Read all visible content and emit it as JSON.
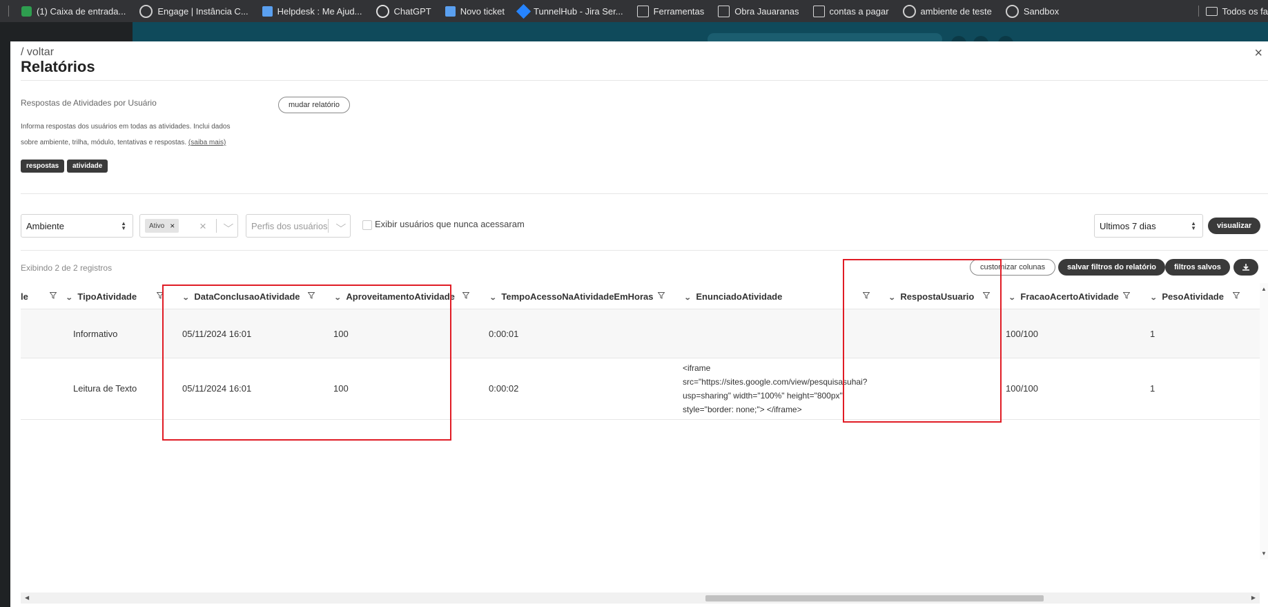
{
  "bookmarks": {
    "items": [
      {
        "label": "(1) Caixa de entrada...",
        "icon": "gmail-icon"
      },
      {
        "label": "Engage | Instância C...",
        "icon": "globe-icon"
      },
      {
        "label": "Helpdesk : Me Ajud...",
        "icon": "page-icon"
      },
      {
        "label": "ChatGPT",
        "icon": "chatgpt-icon"
      },
      {
        "label": "Novo ticket",
        "icon": "page-icon"
      },
      {
        "label": "TunnelHub - Jira Ser...",
        "icon": "jira-icon"
      },
      {
        "label": "Ferramentas",
        "icon": "folder-icon"
      },
      {
        "label": "Obra Jauaranas",
        "icon": "folder-icon"
      },
      {
        "label": "contas a pagar",
        "icon": "folder-icon"
      },
      {
        "label": "ambiente de teste",
        "icon": "globe-icon"
      },
      {
        "label": "Sandbox",
        "icon": "globe-icon"
      }
    ],
    "right_label": "Todos os fa"
  },
  "modal": {
    "back": "/ voltar",
    "title": "Relatórios",
    "close": "×"
  },
  "report": {
    "name": "Respostas de Atividades por Usuário",
    "change_button": "mudar relatório",
    "description": "Informa respostas dos usuários em todas as atividades. Inclui dados sobre ambiente, trilha, módulo, tentativas e respostas.",
    "more_link": "(saiba mais)",
    "tags": [
      "respostas",
      "atividade"
    ]
  },
  "filters": {
    "ambiente": "Ambiente",
    "status_chip": "Ativo",
    "status_chip_remove": "×",
    "clear": "×",
    "profiles_placeholder": "Perfis dos usuários",
    "never_accessed_label": "Exibir usuários que nunca acessaram",
    "period": "Ultimos 7 dias",
    "visualize_button": "visualizar"
  },
  "toolbar": {
    "records": "Exibindo 2 de 2 registros",
    "customize_columns": "customizar colunas",
    "save_filters": "salvar filtros do relatório",
    "saved_filters": "filtros salvos"
  },
  "table": {
    "columns": [
      "le",
      "TipoAtividade",
      "DataConclusaoAtividade",
      "AproveitamentoAtividade",
      "TempoAcessoNaAtividadeEmHoras",
      "EnunciadoAtividade",
      "RespostaUsuario",
      "FracaoAcertoAtividade",
      "PesoAtividade"
    ],
    "rows": [
      {
        "tipo": "Informativo",
        "data": "05/11/2024 16:01",
        "aproveitamento": "100",
        "tempo": "0:00:01",
        "enunciado": "",
        "resposta": "",
        "fracao": "100/100",
        "peso": "1"
      },
      {
        "tipo": "Leitura de Texto",
        "data": "05/11/2024 16:01",
        "aproveitamento": "100",
        "tempo": "0:00:02",
        "enunciado": "<iframe src=\"https://sites.google.com/view/pesquisasuhai?usp=sharing\" width=\"100%\" height=\"800px\" style=\"border: none;\"> </iframe>",
        "resposta": "",
        "fracao": "100/100",
        "peso": "1"
      }
    ]
  },
  "colors": {
    "highlight": "#e01b24",
    "dark_button": "#3a3a3a"
  }
}
